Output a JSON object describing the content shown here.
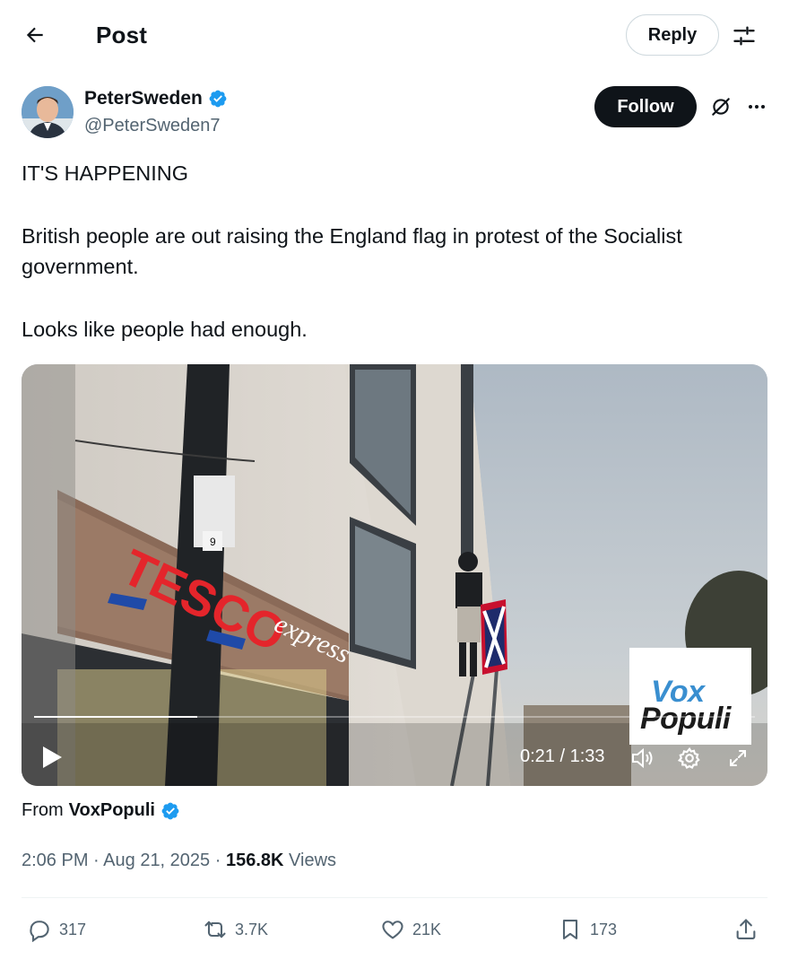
{
  "header": {
    "title": "Post",
    "reply_label": "Reply"
  },
  "author": {
    "name": "PeterSweden",
    "handle": "@PeterSweden7",
    "follow_label": "Follow"
  },
  "tweet": {
    "paragraphs": [
      "IT'S HAPPENING",
      "British people are out raising the England flag in protest of the Socialist government.",
      "Looks like people had enough."
    ]
  },
  "video": {
    "time": "0:21 / 1:33",
    "progress": 0.226,
    "watermark_line1": "Vox",
    "watermark_line2": "Populi",
    "sign_text_1": "TESCO",
    "sign_text_2": "express",
    "pole_tag": "9"
  },
  "source": {
    "prefix": "From",
    "name": "VoxPopuli"
  },
  "meta": {
    "time": "2:06 PM",
    "separator": "·",
    "date": "Aug 21, 2025",
    "views_count": "156.8K",
    "views_label": "Views"
  },
  "actions": {
    "replies": "317",
    "reposts": "3.7K",
    "likes": "21K",
    "bookmarks": "173"
  },
  "colors": {
    "verified": "#1d9bf0",
    "text": "#0f1419",
    "secondary": "#536471",
    "follow_bg": "#0f1419"
  }
}
